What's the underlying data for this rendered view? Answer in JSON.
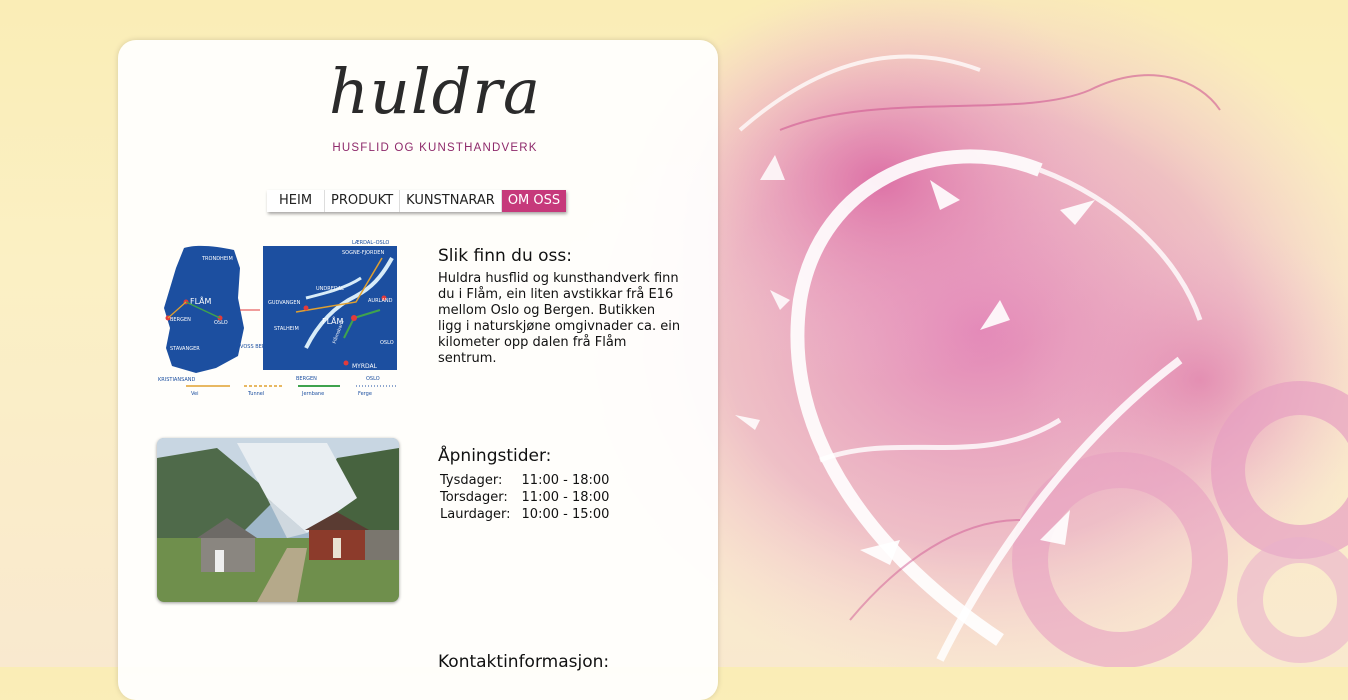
{
  "logo": {
    "title": "huldra",
    "subtitle": "HUSFLID OG KUNSTHANDVERK"
  },
  "nav": {
    "items": [
      {
        "label": "HEIM",
        "active": false
      },
      {
        "label": "PRODUKT",
        "active": false
      },
      {
        "label": "KUNSTNARAR",
        "active": false
      },
      {
        "label": "OM OSS",
        "active": true
      }
    ]
  },
  "directions": {
    "title": "Slik finn du oss:",
    "text": "Huldra husflid og kunsthandverk finn du i Flåm, ein liten avstikkar frå E16 mellom Oslo og Bergen. Butikken ligg i naturskjøne omgivnader ca. ein kilometer opp dalen frå Flåm sentrum."
  },
  "map": {
    "labels_left": [
      "TRONDHEIM",
      "FLÅM",
      "BERGEN",
      "OSLO",
      "STAVANGER",
      "KRISTIANSAND"
    ],
    "labels_right": [
      "LÆRDAL–OSLO",
      "SOGNE-FJORDEN",
      "UNDREDAL",
      "AURLAND",
      "GUDVANGEN",
      "STALHEIM",
      "FLÅM",
      "Flåmsbana",
      "MYRDAL",
      "OSLO",
      "VOSS BERGEN",
      "BERGEN",
      "OSLO"
    ],
    "legend": [
      "Vei",
      "Tunnel",
      "Jernbane",
      "Ferge"
    ]
  },
  "hours": {
    "title": "Åpningstider:",
    "rows": [
      {
        "day": "Tysdager:",
        "time": "11:00 - 18:00"
      },
      {
        "day": "Torsdager:",
        "time": "11:00 - 18:00"
      },
      {
        "day": "Laurdager:",
        "time": "10:00 - 15:00"
      }
    ]
  },
  "contact": {
    "title": "Kontaktinformasjon:"
  },
  "colors": {
    "accent": "#c6397b",
    "map_blue": "#1c4fa0"
  }
}
